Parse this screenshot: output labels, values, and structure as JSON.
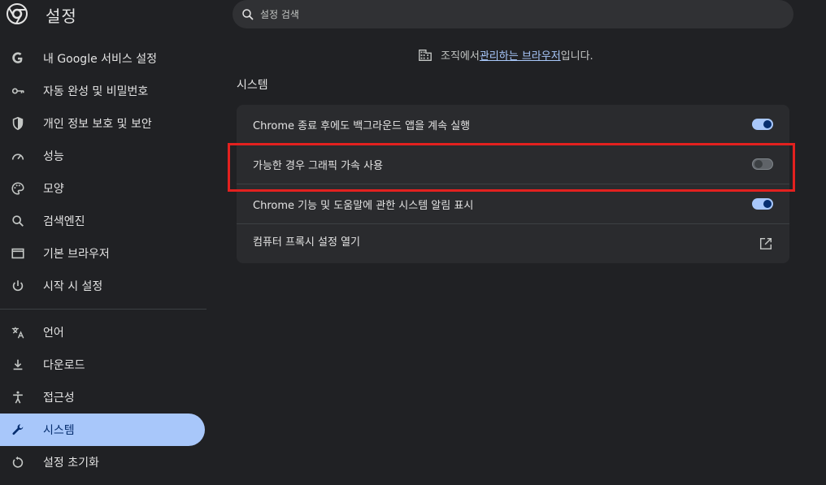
{
  "header": {
    "title": "설정",
    "logo_icon": "chrome-logo-icon",
    "search_placeholder": "설정 검색"
  },
  "sidebar": {
    "items": [
      {
        "label": "내 Google 서비스 설정",
        "icon": "google-g-icon"
      },
      {
        "label": "자동 완성 및 비밀번호",
        "icon": "key-icon"
      },
      {
        "label": "개인 정보 보호 및 보안",
        "icon": "shield-icon"
      },
      {
        "label": "성능",
        "icon": "speedometer-icon"
      },
      {
        "label": "모양",
        "icon": "palette-icon"
      },
      {
        "label": "검색엔진",
        "icon": "search-icon"
      },
      {
        "label": "기본 브라우저",
        "icon": "browser-window-icon"
      },
      {
        "label": "시작 시 설정",
        "icon": "power-icon"
      },
      {
        "label": "언어",
        "icon": "translate-icon"
      },
      {
        "label": "다운로드",
        "icon": "download-icon"
      },
      {
        "label": "접근성",
        "icon": "accessibility-icon"
      },
      {
        "label": "시스템",
        "icon": "wrench-icon",
        "active": true
      },
      {
        "label": "설정 초기화",
        "icon": "reset-icon"
      }
    ]
  },
  "main": {
    "managed_prefix": "조직에서 ",
    "managed_link": "관리하는 브라우저",
    "managed_suffix": "입니다.",
    "section_title": "시스템",
    "rows": [
      {
        "label": "Chrome 종료 후에도 백그라운드 앱을 계속 실행",
        "toggle": "on"
      },
      {
        "label": "가능한 경우 그래픽 가속 사용",
        "toggle": "off"
      },
      {
        "label": "Chrome 기능 및 도움말에 관한 시스템 알림 표시",
        "toggle": "on"
      },
      {
        "label": "컴퓨터 프록시 설정 열기",
        "icon": "open-in-new-icon"
      }
    ]
  },
  "colors": {
    "background": "#202124",
    "accent": "#a8c7fa",
    "highlight": "#e3211f"
  }
}
